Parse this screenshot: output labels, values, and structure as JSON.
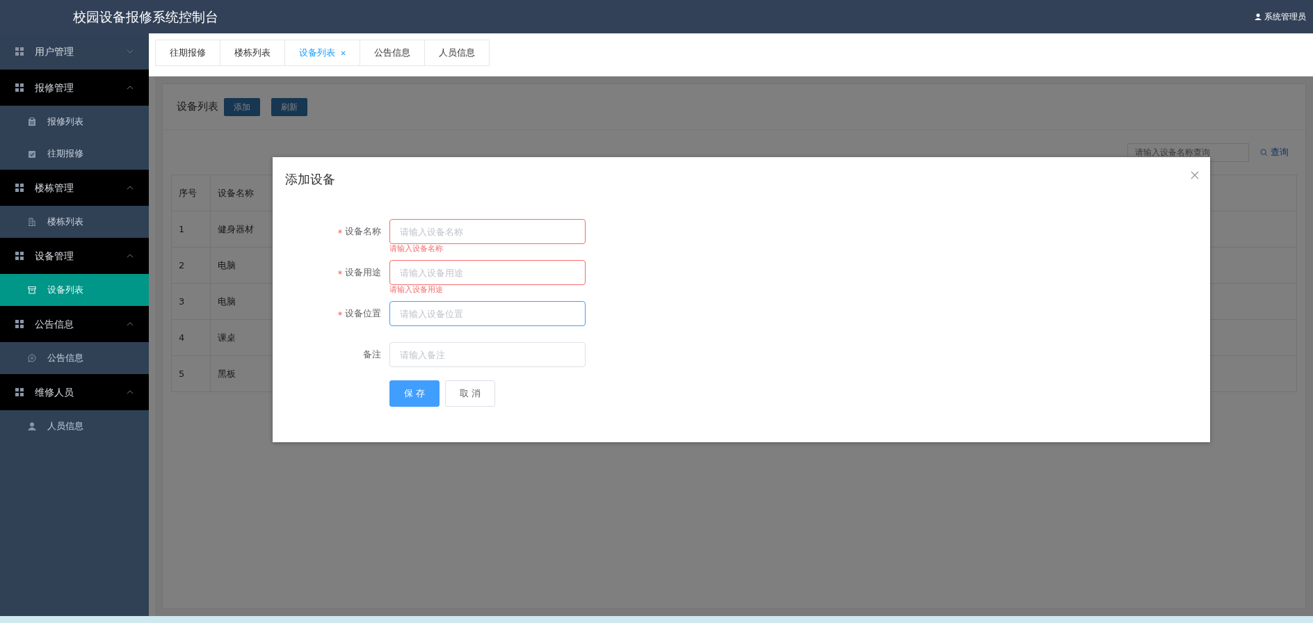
{
  "header": {
    "title": "校园设备报修系统控制台",
    "user": "系统管理员"
  },
  "sidebar": {
    "groups": [
      {
        "label": "用户管理",
        "expanded": false
      },
      {
        "label": "报修管理",
        "expanded": true,
        "items": [
          {
            "label": "报修列表",
            "kind": "clipboard",
            "selected": false
          },
          {
            "label": "往期报修",
            "kind": "checklist",
            "selected": false
          }
        ]
      },
      {
        "label": "楼栋管理",
        "expanded": true,
        "items": [
          {
            "label": "楼栋列表",
            "kind": "building",
            "selected": false
          }
        ]
      },
      {
        "label": "设备管理",
        "expanded": true,
        "items": [
          {
            "label": "设备列表",
            "kind": "archive",
            "selected": true
          }
        ]
      },
      {
        "label": "公告信息",
        "expanded": true,
        "items": [
          {
            "label": "公告信息",
            "kind": "chat",
            "selected": false
          }
        ]
      },
      {
        "label": "维修人员",
        "expanded": true,
        "items": [
          {
            "label": "人员信息",
            "kind": "person",
            "selected": false
          }
        ]
      }
    ]
  },
  "tabs": [
    {
      "label": "往期报修",
      "selected": false
    },
    {
      "label": "楼栋列表",
      "selected": false
    },
    {
      "label": "设备列表",
      "selected": true
    },
    {
      "label": "公告信息",
      "selected": false
    },
    {
      "label": "人员信息",
      "selected": false
    }
  ],
  "list_card": {
    "title": "设备列表",
    "buttons": [
      "添加",
      "刷新"
    ],
    "search": {
      "placeholder": "请输入设备名称查询"
    },
    "search_button": "查询"
  },
  "table": {
    "columns": [
      "序号",
      "设备名称"
    ],
    "rows": [
      [
        "1",
        "健身器材"
      ],
      [
        "2",
        "电脑"
      ],
      [
        "3",
        "电脑"
      ],
      [
        "4",
        "课桌"
      ],
      [
        "5",
        "黑板"
      ]
    ]
  },
  "dialog": {
    "title": "添加设备",
    "fields": [
      {
        "label": "设备名称",
        "required": true,
        "placeholder": "请输入设备名称",
        "error": "请输入设备名称",
        "focused": false
      },
      {
        "label": "设备用途",
        "required": true,
        "placeholder": "请输入设备用途",
        "error": "请输入设备用途",
        "focused": false
      },
      {
        "label": "设备位置",
        "required": true,
        "placeholder": "请输入设备位置",
        "focused": true
      },
      {
        "label": "备注",
        "required": false,
        "placeholder": "请输入备注",
        "focused": false
      }
    ],
    "buttons": [
      {
        "label": "保 存",
        "kind": "primary"
      },
      {
        "label": "取 消",
        "kind": "default"
      }
    ]
  }
}
